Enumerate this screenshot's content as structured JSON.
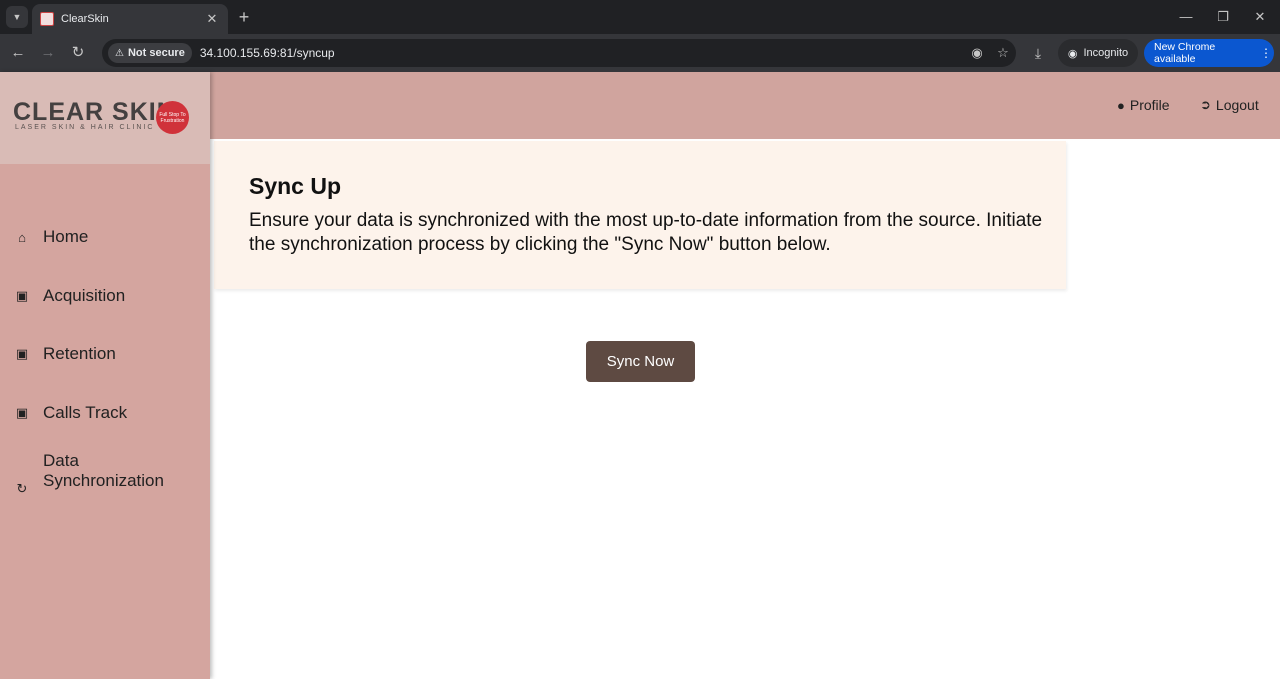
{
  "browser": {
    "tab_title": "ClearSkin",
    "security_label": "Not secure",
    "url": "34.100.155.69:81/syncup",
    "incognito_label": "Incognito",
    "update_label": "New Chrome available"
  },
  "brand": {
    "name": "CLEAR SKIN",
    "tagline": "LASER SKIN & HAIR CLINIC",
    "badge_text": "Full Stop To Frustration"
  },
  "sidebar": {
    "items": [
      {
        "label": "Home",
        "icon": "home-icon"
      },
      {
        "label": "Acquisition",
        "icon": "folder-plus-icon"
      },
      {
        "label": "Retention",
        "icon": "folder-plus-icon"
      },
      {
        "label": "Calls Track",
        "icon": "folder-plus-icon"
      },
      {
        "label": "Data Synchronization",
        "icon": "refresh-icon"
      }
    ]
  },
  "header": {
    "profile_label": "Profile",
    "logout_label": "Logout"
  },
  "main": {
    "title": "Sync Up",
    "description": "Ensure your data is synchronized with the most up-to-date information from the source. Initiate the synchronization process by clicking the \"Sync Now\" button below.",
    "sync_button_label": "Sync Now"
  },
  "colors": {
    "sidebar": "#d4a59f",
    "topbar": "#d0a49e",
    "card": "#fdf3eb",
    "button": "#5e4a42"
  }
}
